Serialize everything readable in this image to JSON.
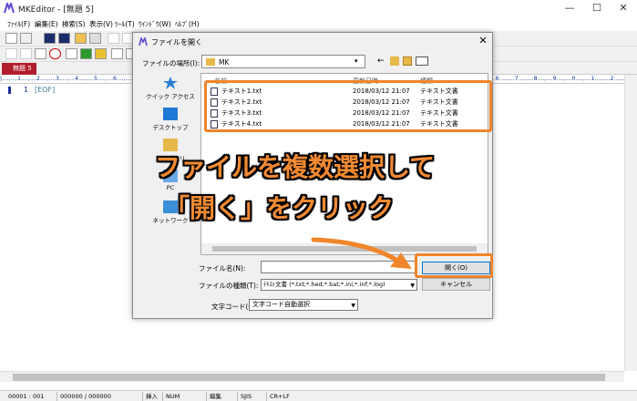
{
  "window": {
    "title": "MKEditor - [無題 5]",
    "controls": [
      "—",
      "☐",
      "✕"
    ]
  },
  "menu": [
    {
      "label": "ﾌｧｲﾙ(F)"
    },
    {
      "label": "編集(E)"
    },
    {
      "label": "検索(S)"
    },
    {
      "label": "表示(V)"
    },
    {
      "label": "ﾂｰﾙ(T)"
    },
    {
      "label": "ｳｲﾝﾄﾞｳ(W)"
    },
    {
      "label": "ﾍﾙﾌﾟ(H)"
    }
  ],
  "tab": {
    "label": "無題 5"
  },
  "editor": {
    "line_number": "1",
    "eof_text": "[EOF]",
    "ruler": "|....,....1....,....2....,....3....,....4....,....5....,....6....,....7....,....8....,....9....,....0....,....1....,....2....,....3....,....4....,....5....,....6....,....7....,....8....,....9....,....0....,....1....,....2....,....3....,....4....,....5....,....6....,....7....,....8....,....9....,....0....,....1....,....2....,....3....,"
  },
  "status": {
    "position": "00001 : 001",
    "count": "000000 / 000000",
    "insert": "挿入",
    "numlock": "NUM",
    "mode": "編集",
    "encoding": "SJIS",
    "newline": "CR+LF"
  },
  "dialog": {
    "title": "ファイルを開く",
    "lookin_label": "ファイルの場所(I):",
    "lookin_value": "MK",
    "places": [
      {
        "label": "クイック アクセス",
        "icon": "star-icon"
      },
      {
        "label": "デスクトップ",
        "icon": "desktop-icon"
      },
      {
        "label": "ライブラリ",
        "icon": "library-icon"
      },
      {
        "label": "PC",
        "icon": "pc-icon"
      },
      {
        "label": "ネットワーク",
        "icon": "network-icon"
      }
    ],
    "columns": {
      "name": "名前",
      "date": "更新日時",
      "type": "種類"
    },
    "files": [
      {
        "name": "テキスト1.txt",
        "date": "2018/03/12 21:07",
        "type": "テキスト文書"
      },
      {
        "name": "テキスト2.txt",
        "date": "2018/03/12 21:07",
        "type": "テキスト文書"
      },
      {
        "name": "テキスト3.txt",
        "date": "2018/03/12 21:07",
        "type": "テキスト文書"
      },
      {
        "name": "テキスト4.txt",
        "date": "2018/03/12 21:07",
        "type": "テキスト文書"
      }
    ],
    "filename_label": "ファイル名(N):",
    "filename_value": "",
    "filetype_label": "ファイルの種類(T):",
    "filetype_value": "ﾃｷｽﾄ文書 (*.txt;*.hed;*.bat;*.ini;*.inf;*.log)",
    "encoding_label": "文字コード(C):",
    "encoding_value": "文字コード自動選択",
    "open_label": "開く(O)",
    "cancel_label": "キャンセル"
  },
  "annotation": {
    "line1": "ファイルを複数選択して",
    "line2": "「開く」をクリック",
    "color": "#f28a33"
  }
}
